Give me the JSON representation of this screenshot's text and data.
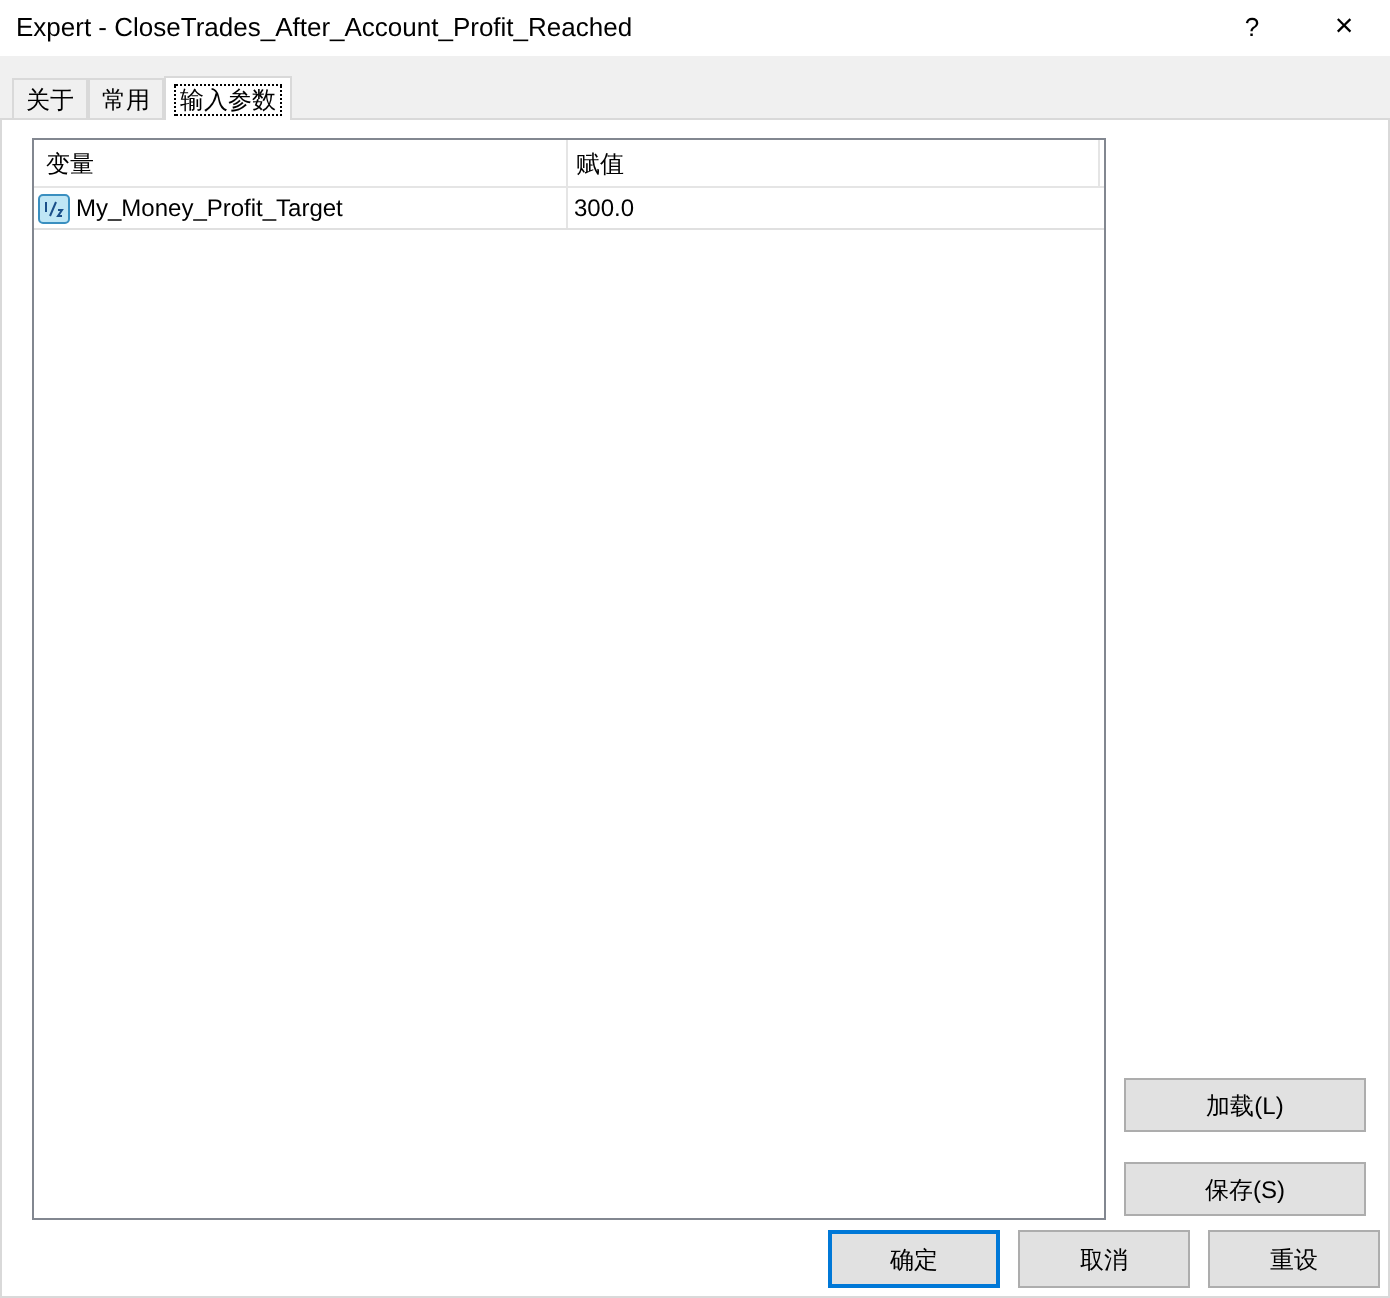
{
  "window": {
    "title": "Expert - CloseTrades_After_Account_Profit_Reached",
    "help": "?",
    "close": "×"
  },
  "tabs": [
    {
      "label": "关于",
      "selected": false
    },
    {
      "label": "常用",
      "selected": false
    },
    {
      "label": "输入参数",
      "selected": true
    }
  ],
  "table": {
    "columns": [
      "变量",
      "赋值"
    ],
    "rows": [
      {
        "name": "My_Money_Profit_Target",
        "value": "300.0"
      }
    ]
  },
  "side_buttons": [
    "加载(L)",
    "保存(S)"
  ],
  "buttons": [
    {
      "label": "确定",
      "default": true
    },
    {
      "label": "取消",
      "default": false
    },
    {
      "label": "重设",
      "default": false
    }
  ]
}
